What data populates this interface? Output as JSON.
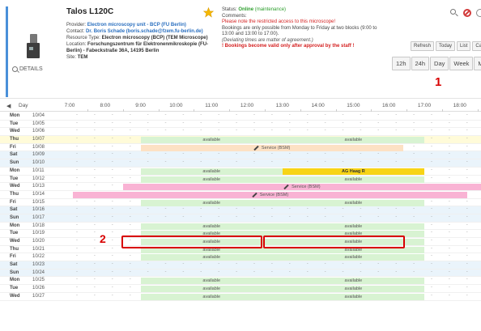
{
  "resource": {
    "title": "Talos L120C",
    "provider_label": "Provider:",
    "provider_value": "Electron microscopy unit - BCP (FU Berlin)",
    "contact_label": "Contact:",
    "contact_value": "Dr. Boris Schade (boris.schade@fzem.fu-berlin.de)",
    "type_label": "Resource Type:",
    "type_value": "Electron microscopy (BCP) (TEM Microscope)",
    "location_label": "Location:",
    "location_value": "Forschungszentrum für Elektronenmikroskopie (FU-Berlin) - Fabeckstraße 36A, 14195 Berlin",
    "site_label": "Site:",
    "site_value": "TEM",
    "details_label": "DETAILS"
  },
  "status": {
    "status_label": "Status:",
    "status_value": "Online",
    "status_note": "(maintenance)",
    "comments_label": "Comments:",
    "line1": "Please note the restricted access to this microscope!",
    "line2": "Bookings are only possible from Monday to Friday at two blocks (9:00 to 13:00 and 13:00 to 17:00).",
    "line3": "(Deviating times are matter of agreement.)",
    "line4": "! Bookings become valid only after approval by the staff !"
  },
  "toolbar": {
    "refresh": "Refresh",
    "today": "Today",
    "list": "List",
    "calendar": "Calenda",
    "h12": "12h",
    "h24": "24h",
    "day": "Day",
    "week": "Week",
    "month": "Month"
  },
  "annotations": {
    "one": "1",
    "two": "2"
  },
  "calendar": {
    "day_header": "Day",
    "times": [
      "7:00",
      "8:00",
      "9:00",
      "10:00",
      "11:00",
      "12:00",
      "13:00",
      "14:00",
      "15:00",
      "16:00",
      "17:00",
      "18:00"
    ],
    "available_label": "available",
    "days": [
      {
        "name": "Mon",
        "date": "10/04"
      },
      {
        "name": "Tue",
        "date": "10/05"
      },
      {
        "name": "Wed",
        "date": "10/06"
      },
      {
        "name": "Thu",
        "date": "10/07"
      },
      {
        "name": "Fri",
        "date": "10/08"
      },
      {
        "name": "Sat",
        "date": "10/09"
      },
      {
        "name": "Sun",
        "date": "10/10"
      },
      {
        "name": "Mon",
        "date": "10/11"
      },
      {
        "name": "Tue",
        "date": "10/12"
      },
      {
        "name": "Wed",
        "date": "10/13"
      },
      {
        "name": "Thu",
        "date": "10/14"
      },
      {
        "name": "Fri",
        "date": "10/15"
      },
      {
        "name": "Sat",
        "date": "10/16"
      },
      {
        "name": "Sun",
        "date": "10/17"
      },
      {
        "name": "Mon",
        "date": "10/18"
      },
      {
        "name": "Tue",
        "date": "10/19"
      },
      {
        "name": "Wed",
        "date": "10/20"
      },
      {
        "name": "Thu",
        "date": "10/21"
      },
      {
        "name": "Fri",
        "date": "10/22"
      },
      {
        "name": "Sat",
        "date": "10/23"
      },
      {
        "name": "Sun",
        "date": "10/24"
      },
      {
        "name": "Mon",
        "date": "10/25"
      },
      {
        "name": "Tue",
        "date": "10/26"
      },
      {
        "name": "Wed",
        "date": "10/27"
      }
    ],
    "events": {
      "service_fri_1008": "Service (BSM)",
      "ag_haag": "AG Haag R",
      "service_wed_1013": "Service (BSM)",
      "service_thu_1014": "Service (BSM)"
    }
  },
  "colors": {
    "available": "#d8f3d2",
    "booking_yellow": "#f7d416",
    "service_pink": "#f9b3d4",
    "weekend": "#eaf4fb",
    "today": "#fffbd9",
    "highlight": "#d80000"
  }
}
